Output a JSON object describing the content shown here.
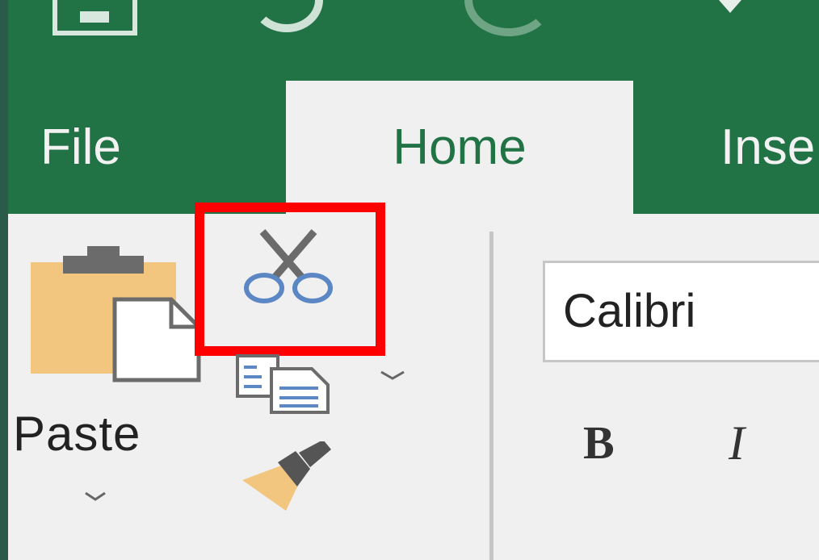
{
  "tabs": {
    "file": "File",
    "home": "Home",
    "insert": "Inse"
  },
  "clipboard": {
    "paste_label": "Paste",
    "cut_icon": "scissors-icon",
    "copy_icon": "copy-icon",
    "format_painter_icon": "paintbrush-icon"
  },
  "font": {
    "name": "Calibri",
    "bold_label": "B",
    "italic_label": "I"
  },
  "colors": {
    "ribbon_green": "#217346",
    "ribbon_body": "#f0f0f0",
    "highlight": "#ff0000"
  }
}
